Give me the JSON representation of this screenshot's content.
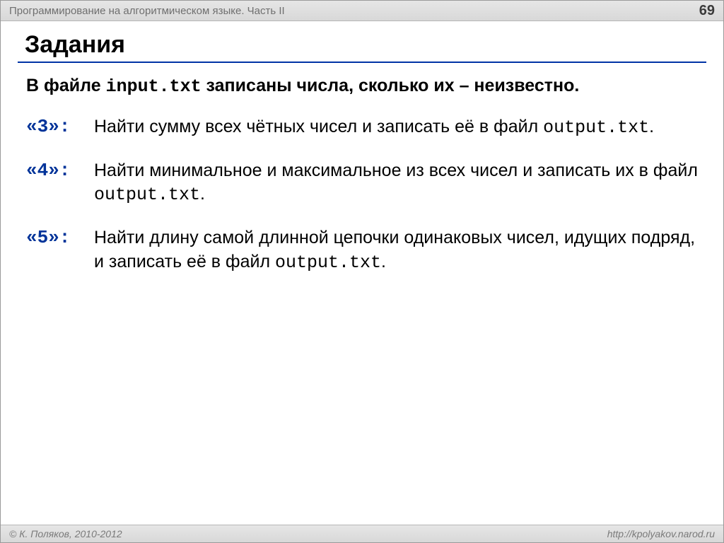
{
  "header": {
    "title": "Программирование на алгоритмическом языке. Часть II",
    "page_number": "69"
  },
  "heading": "Задания",
  "intro": {
    "pre": "В файле ",
    "file": "input.txt",
    "post": " записаны числа, сколько их – неизвестно."
  },
  "tasks": [
    {
      "label": "«3»:",
      "text_pre": "  Найти сумму всех чётных чисел и записать её в файл ",
      "file": "output.txt",
      "text_post": "."
    },
    {
      "label": "«4»:",
      "text_pre": "  Найти минимальное и максимальное из всех чисел и записать их в файл ",
      "file": "output.txt",
      "text_post": "."
    },
    {
      "label": "«5»:",
      "text_pre": "  Найти длину самой длинной цепочки одинаковых чисел, идущих подряд, и записать её в файл ",
      "file": "output.txt",
      "text_post": "."
    }
  ],
  "footer": {
    "copyright": "© К. Поляков, 2010-2012",
    "url": "http://kpolyakov.narod.ru"
  }
}
